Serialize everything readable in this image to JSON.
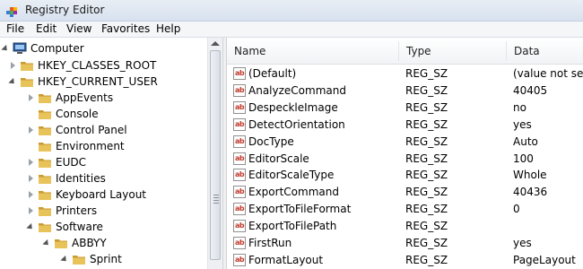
{
  "window": {
    "title": "Registry Editor"
  },
  "menu": [
    "File",
    "Edit",
    "View",
    "Favorites",
    "Help"
  ],
  "tree": [
    {
      "label": "Computer",
      "state": "expanded",
      "icon": "computer-icon"
    },
    {
      "label": "HKEY_CLASSES_ROOT",
      "state": "collapsed",
      "icon": "folder-icon"
    },
    {
      "label": "HKEY_CURRENT_USER",
      "state": "expanded",
      "icon": "folder-icon"
    },
    {
      "label": "AppEvents",
      "state": "collapsed",
      "icon": "folder-icon"
    },
    {
      "label": "Console",
      "state": "none",
      "icon": "folder-icon"
    },
    {
      "label": "Control Panel",
      "state": "collapsed",
      "icon": "folder-icon"
    },
    {
      "label": "Environment",
      "state": "none",
      "icon": "folder-icon"
    },
    {
      "label": "EUDC",
      "state": "collapsed",
      "icon": "folder-icon"
    },
    {
      "label": "Identities",
      "state": "collapsed",
      "icon": "folder-icon"
    },
    {
      "label": "Keyboard Layout",
      "state": "collapsed",
      "icon": "folder-icon"
    },
    {
      "label": "Printers",
      "state": "collapsed",
      "icon": "folder-icon"
    },
    {
      "label": "Software",
      "state": "expanded",
      "icon": "folder-icon"
    },
    {
      "label": "ABBYY",
      "state": "expanded",
      "icon": "folder-icon"
    },
    {
      "label": "Sprint",
      "state": "expanded",
      "icon": "folder-icon"
    }
  ],
  "list": {
    "columns": [
      "Name",
      "Type",
      "Data"
    ],
    "rows": [
      {
        "name": "(Default)",
        "type": "REG_SZ",
        "data": "(value not set)"
      },
      {
        "name": "AnalyzeCommand",
        "type": "REG_SZ",
        "data": "40405"
      },
      {
        "name": "DespeckleImage",
        "type": "REG_SZ",
        "data": "no"
      },
      {
        "name": "DetectOrientation",
        "type": "REG_SZ",
        "data": "yes"
      },
      {
        "name": "DocType",
        "type": "REG_SZ",
        "data": "Auto"
      },
      {
        "name": "EditorScale",
        "type": "REG_SZ",
        "data": "100"
      },
      {
        "name": "EditorScaleType",
        "type": "REG_SZ",
        "data": "Whole"
      },
      {
        "name": "ExportCommand",
        "type": "REG_SZ",
        "data": "40436"
      },
      {
        "name": "ExportToFileFormat",
        "type": "REG_SZ",
        "data": "0"
      },
      {
        "name": "ExportToFilePath",
        "type": "REG_SZ",
        "data": ""
      },
      {
        "name": "FirstRun",
        "type": "REG_SZ",
        "data": "yes"
      },
      {
        "name": "FormatLayout",
        "type": "REG_SZ",
        "data": "PageLayout"
      }
    ],
    "value_icon_text": "ab"
  },
  "colors": {
    "folder": "#e8c35a",
    "folder_dark": "#c99a2e",
    "value_icon": "#c0392b"
  }
}
